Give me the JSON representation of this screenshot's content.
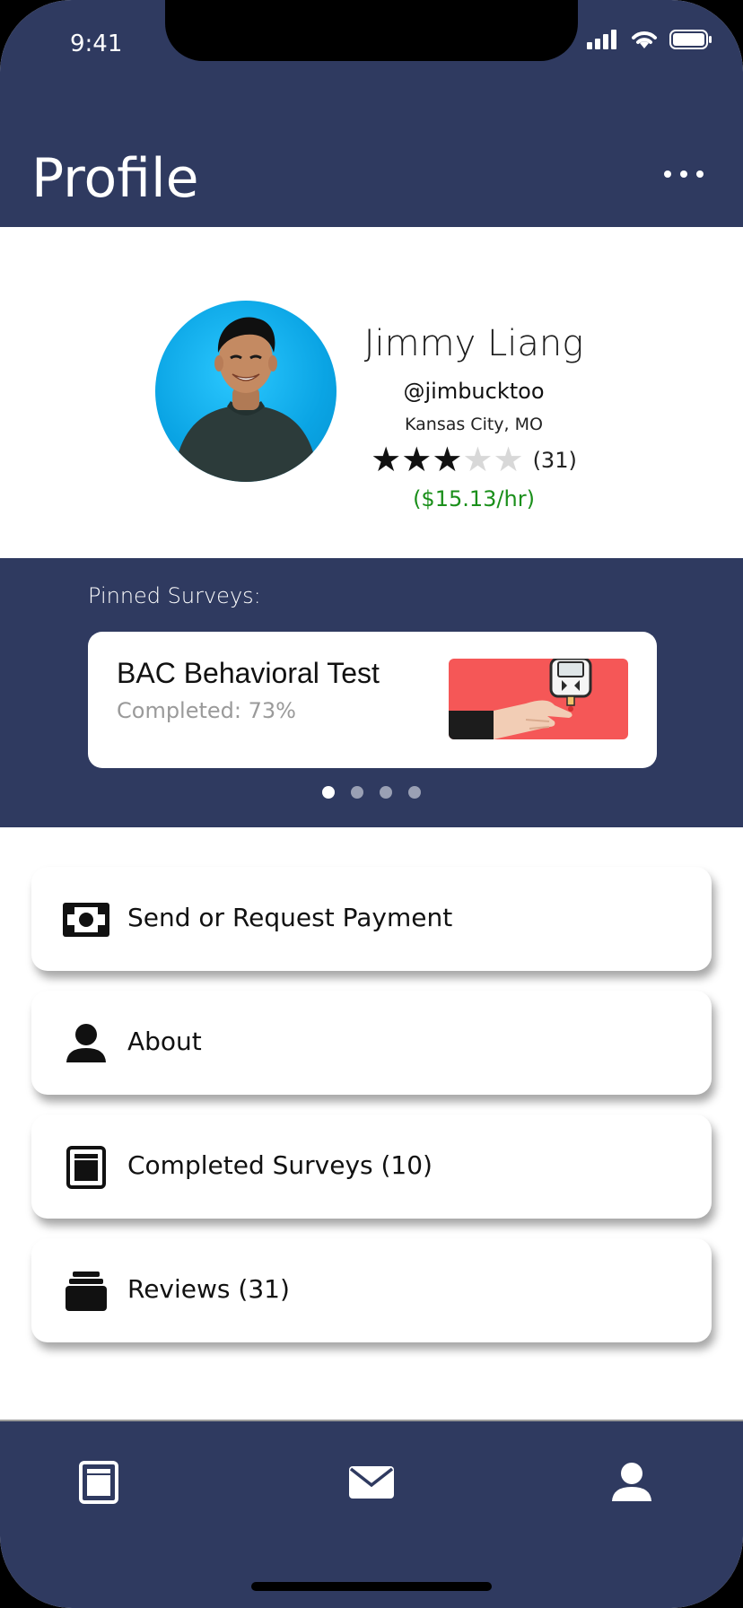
{
  "status_bar": {
    "time": "9:41"
  },
  "header": {
    "title": "Profile"
  },
  "profile": {
    "name": "Jimmy Liang",
    "handle": "@jimbucktoo",
    "location": "Kansas City, MO",
    "rating_stars": 3,
    "rating_max": 5,
    "rating_count": "(31)",
    "hourly_rate": "($15.13/hr)"
  },
  "pinned": {
    "label": "Pinned Surveys:",
    "card": {
      "title": "BAC Behavioral Test",
      "subtitle": "Completed: 73%",
      "image_icon": "glucose-meter-illustration"
    },
    "page_count": 4,
    "active_page": 0
  },
  "menu": {
    "items": [
      {
        "label": "Send or Request Payment",
        "icon": "money-icon"
      },
      {
        "label": "About",
        "icon": "person-icon"
      },
      {
        "label": "Completed Surveys (10)",
        "icon": "survey-icon"
      },
      {
        "label": "Reviews (31)",
        "icon": "stack-icon"
      }
    ]
  },
  "tabbar": {
    "tabs": [
      {
        "icon": "survey-tab-icon"
      },
      {
        "icon": "mail-icon"
      },
      {
        "icon": "profile-icon"
      }
    ]
  },
  "colors": {
    "navy": "#2f3a60",
    "rate_green": "#1a8f1a",
    "card_image_bg": "#f55757"
  }
}
